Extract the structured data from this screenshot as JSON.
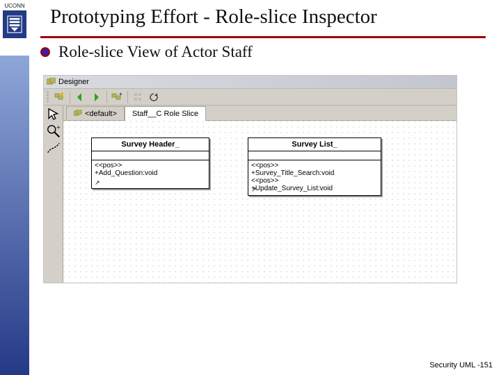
{
  "header": {
    "uconn_label": "UCONN",
    "title": "Prototyping Effort - Role-slice Inspector"
  },
  "bullet": {
    "text": "Role-slice View of Actor Staff"
  },
  "app": {
    "window_title": "Designer",
    "tabs": {
      "default": "<default>",
      "active": "Staff__C Role Slice"
    },
    "class1": {
      "name": "Survey Header_",
      "ops": "<<pos>>\n+Add_Question:void"
    },
    "class2": {
      "name": "Survey List_",
      "ops": "<<pos>>\n+Survey_Title_Search:void\n<<pos>>\n+Update_Survey_List:void"
    }
  },
  "footer": "Security UML -151"
}
